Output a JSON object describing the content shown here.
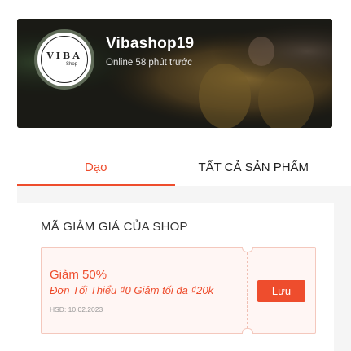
{
  "shop": {
    "name": "Vibashop19",
    "status": "Online 58 phút trước",
    "avatar_brand": "VIBA",
    "avatar_sub": "Shop"
  },
  "tabs": [
    {
      "label": "Dạo",
      "active": true
    },
    {
      "label": "TẤT CẢ SẢN PHẨM",
      "active": false
    }
  ],
  "vouchers_section": {
    "title": "MÃ GIẢM GIÁ CỦA SHOP",
    "items": [
      {
        "title": "Giảm 50%",
        "description": "Đơn Tối Thiểu ₫0 Giảm tối đa ₫20k",
        "expiry": "HSD: 10.02.2023",
        "button_label": "Lưu"
      }
    ]
  },
  "colors": {
    "accent": "#ee4d2d",
    "voucher_bg": "#fff6f4",
    "section_bg": "#f5f5f5"
  }
}
